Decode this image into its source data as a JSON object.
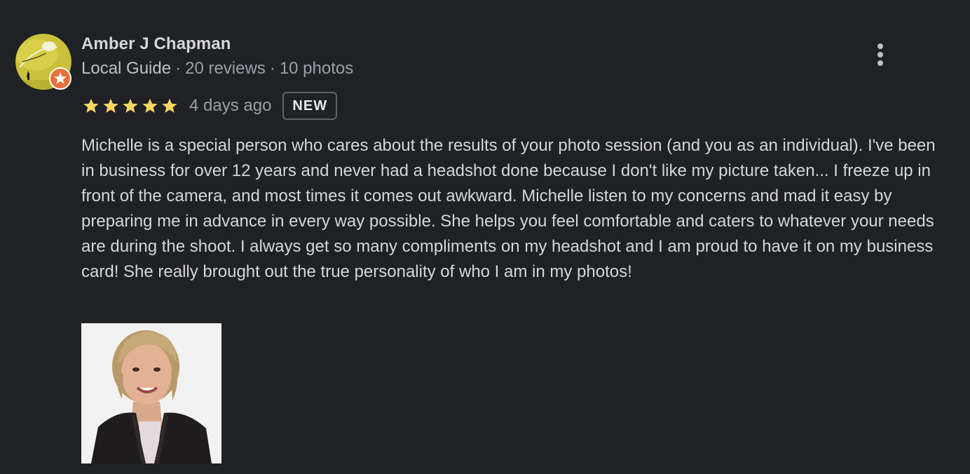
{
  "review": {
    "author": {
      "name": "Amber J Chapman",
      "level": "Local Guide",
      "reviews_count": "20 reviews",
      "photos_count": "10 photos",
      "separator": "·",
      "badge_color": "#e8713c"
    },
    "rating": 5,
    "rating_max": 5,
    "star_color": "#fdd663",
    "date": "4 days ago",
    "badge": "NEW",
    "text": "Michelle is a special person who cares about the results of your photo session (and you as an individual). I've been in business for over 12 years and never had a headshot done because I don't like my picture taken... I freeze up in front of the camera, and most times it comes out awkward. Michelle listen to my concerns and mad it easy by preparing me in advance in every way possible. She helps you feel comfortable and caters to whatever your needs are during the shoot. I always get so many compliments on my headshot and I am proud to have it on my business card! She really brought out the true personality of who I am in my photos!",
    "menu_icon": "more-vert-icon",
    "photos": [
      "headshot-photo"
    ]
  }
}
